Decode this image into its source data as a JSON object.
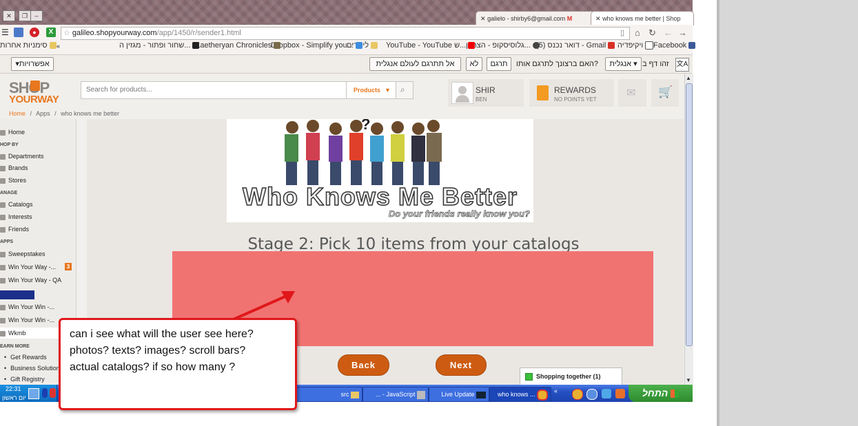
{
  "browser": {
    "tabs": [
      {
        "title": "galielo - shirby6@gmail.com"
      },
      {
        "title": "who knows me better | Shop"
      }
    ],
    "url_host": "galileo.shopyourway.com",
    "url_path": "/app/1450/r/sender1.html",
    "bookmarks": [
      "Facebook",
      "ויקיפדיה",
      "דואר נכנס (5) - Gmail",
      "גלוסיסקופ - הצרגין...",
      "YouTube - YouTube ש...",
      "לינודים",
      "Dropbox - Simplify you...",
      "Kaetheryan Chronicles",
      "שחור ופתור - מגזין ה...",
      "סימניות אחרות"
    ],
    "translate_bar": {
      "page_is_in": "זהו דף ב",
      "language": "אנגלית",
      "question": "האם ברצונך לתרגם אותו?",
      "translate": "תרגם",
      "no": "לא",
      "never": "אל תתרגם לעולם אנגלית",
      "options": "אפשרויות"
    }
  },
  "site": {
    "logo_top": "SHOP",
    "logo_bottom": "YOURWAY",
    "search_placeholder": "Search for products...",
    "search_category": "Products",
    "user_name": "SHIR",
    "user_sub": "BEN",
    "rewards_title": "REWARDS",
    "rewards_sub": "NO POINTS YET",
    "breadcrumb": [
      "Home",
      "Apps",
      "who knows me better"
    ]
  },
  "sidebar": {
    "items": [
      {
        "type": "item",
        "label": "Home"
      },
      {
        "type": "head",
        "label": "HOP BY"
      },
      {
        "type": "item",
        "label": "Departments"
      },
      {
        "type": "item",
        "label": "Brands"
      },
      {
        "type": "item",
        "label": "Stores"
      },
      {
        "type": "head",
        "label": "ANAGE"
      },
      {
        "type": "item",
        "label": "Catalogs"
      },
      {
        "type": "item",
        "label": "Interests"
      },
      {
        "type": "item",
        "label": "Friends"
      },
      {
        "type": "head",
        "label": "APPS"
      },
      {
        "type": "item",
        "label": "Sweepstakes"
      },
      {
        "type": "item",
        "label": "Win Your Way -...",
        "badge": "3"
      },
      {
        "type": "item",
        "label": "Win Your Way - QA"
      },
      {
        "type": "item",
        "label": "Win Your Win -..."
      },
      {
        "type": "item",
        "label": "Win Your Win -..."
      },
      {
        "type": "item",
        "label": "Wkmb"
      },
      {
        "type": "head",
        "label": "EARN MORE"
      },
      {
        "type": "item",
        "label": "Get Rewards"
      },
      {
        "type": "item",
        "label": "Business Solution"
      },
      {
        "type": "item",
        "label": "Gift Registry"
      }
    ]
  },
  "main": {
    "banner_title": "Who Knows Me Better",
    "banner_subtitle": "Do your friends really know you?",
    "stage_title": "Stage 2: Pick 10 items from your catalogs",
    "back_label": "Back",
    "next_label": "Next",
    "shopping_together": "Shopping together (1)"
  },
  "taskbar": {
    "clock": "22:31",
    "day": "יום ראשון",
    "tasks": [
      "src",
      "... - JavaScript",
      "Live Update",
      "who knows ..."
    ],
    "start_label": "התחל"
  },
  "callout": {
    "lines": [
      "can i see what will the user see here?",
      "photos? texts? images? scroll bars?",
      "actual catalogs? if so how many ?"
    ]
  },
  "colors": {
    "accent": "#e8771e",
    "placeholder_box": "#f17371",
    "button": "#cd5c12",
    "callout_border": "#e0181b"
  }
}
